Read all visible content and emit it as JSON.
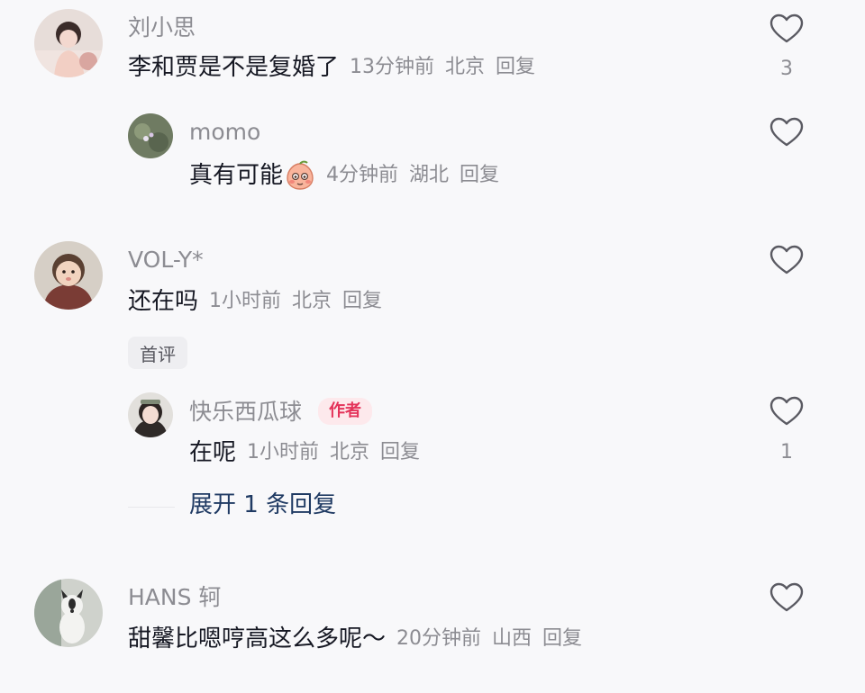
{
  "comments": [
    {
      "name": "刘小思",
      "content": "李和贾是不是复婚了",
      "time": "13分钟前",
      "location": "北京",
      "reply_label": "回复",
      "like_count": "3"
    },
    {
      "name": "momo",
      "content": "真有可能",
      "time": "4分钟前",
      "location": "湖北",
      "reply_label": "回复",
      "like_count": ""
    },
    {
      "name": "VOL-Y*",
      "content": "还在吗",
      "time": "1小时前",
      "location": "北京",
      "reply_label": "回复",
      "badge": "首评",
      "like_count": ""
    },
    {
      "name": "快乐西瓜球",
      "author_badge": "作者",
      "content": "在呢",
      "time": "1小时前",
      "location": "北京",
      "reply_label": "回复",
      "like_count": "1",
      "expand_label": "展开 1 条回复"
    },
    {
      "name": "HANS 轲",
      "content": "甜馨比嗯哼高这么多呢～",
      "time": "20分钟前",
      "location": "山西",
      "reply_label": "回复",
      "like_count": ""
    }
  ],
  "colors": {
    "background": "#f8f8fa",
    "text_primary": "#161823",
    "text_secondary": "#8c8c92",
    "author_badge_bg": "#fde9ec",
    "author_badge_text": "#e4335a",
    "expand_link": "#1f3a63"
  },
  "icons": {
    "like": "heart-outline-icon",
    "emoji": "blushing-peach-emoji"
  }
}
